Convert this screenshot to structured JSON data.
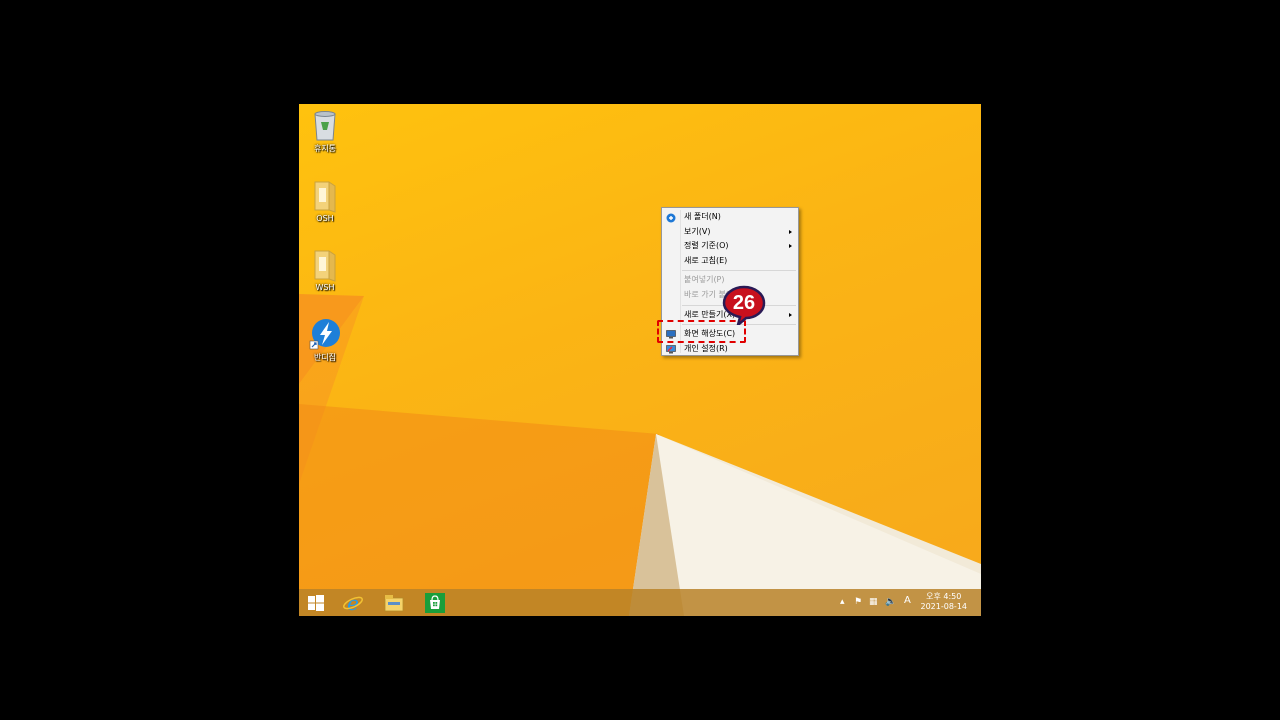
{
  "desktop": {
    "icons": [
      {
        "label": "휴지통",
        "icon": "recycle-bin-icon"
      },
      {
        "label": "OSH",
        "icon": "folder-icon"
      },
      {
        "label": "WSH",
        "icon": "folder-icon"
      },
      {
        "label": "반디집",
        "icon": "bandizip-icon"
      }
    ]
  },
  "context_menu": {
    "items": [
      {
        "label": "새 폴더(N)",
        "icon": "new-folder-icon",
        "submenu": false,
        "disabled": false
      },
      {
        "label": "보기(V)",
        "submenu": true,
        "disabled": false
      },
      {
        "label": "정렬 기준(O)",
        "submenu": true,
        "disabled": false
      },
      {
        "label": "새로 고침(E)",
        "submenu": false,
        "disabled": false
      },
      {
        "label": "붙여넣기(P)",
        "submenu": false,
        "disabled": true
      },
      {
        "label": "바로 가기 붙여넣기(S)",
        "submenu": false,
        "disabled": true
      },
      {
        "label": "새로 만들기(X)",
        "submenu": true,
        "disabled": false
      },
      {
        "label": "화면 해상도(C)",
        "icon": "display-icon",
        "submenu": false,
        "disabled": false
      },
      {
        "label": "개인 설정(R)",
        "icon": "personalize-icon",
        "submenu": false,
        "disabled": false
      }
    ]
  },
  "annotation": {
    "step": "26",
    "color": "#e00000",
    "badge_color": "#c8101e"
  },
  "taskbar": {
    "buttons": [
      "start-icon",
      "internet-explorer-icon",
      "file-explorer-icon",
      "store-icon"
    ],
    "tray": {
      "ime": "A",
      "time": "오후 4:50",
      "date": "2021-08-14"
    }
  }
}
